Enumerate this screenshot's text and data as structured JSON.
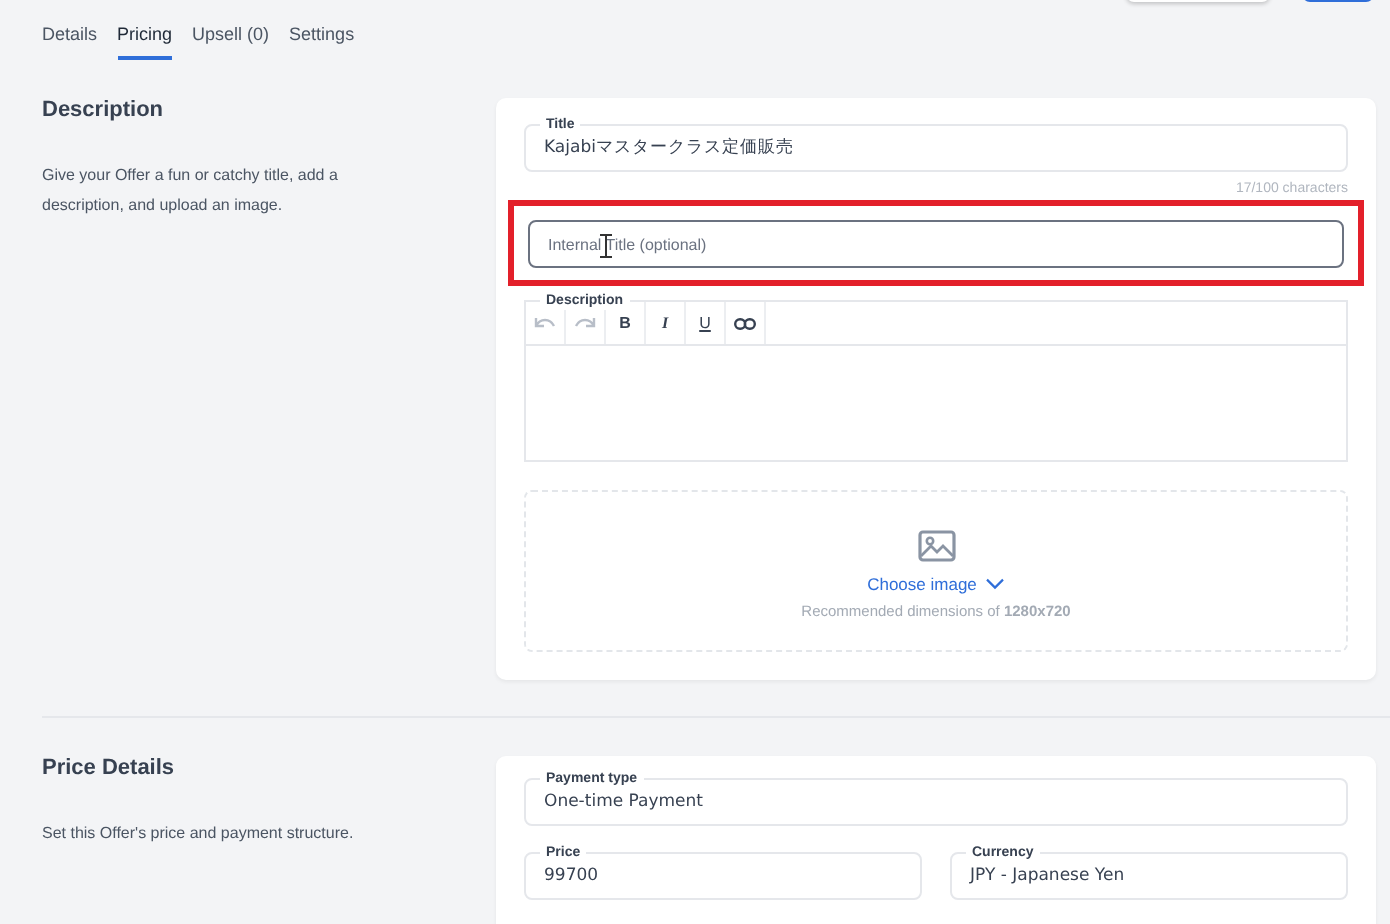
{
  "top_buttons": [
    {
      "kind": "secondary"
    },
    {
      "kind": "primary"
    }
  ],
  "tabs": [
    {
      "label": "Details",
      "selected": false
    },
    {
      "label": "Pricing",
      "selected": true
    },
    {
      "label": "Upsell (0)",
      "selected": false
    },
    {
      "label": "Settings",
      "selected": false
    }
  ],
  "description_section": {
    "heading": "Description",
    "text": "Give your Offer a fun or catchy title, add a description, and upload an image.",
    "title_field": {
      "label": "Title",
      "value": "Kajabiマスタークラス定価販売",
      "counter": "17/100 characters"
    },
    "internal_title_field": {
      "placeholder": "Internal Title (optional)",
      "highlighted": true
    },
    "description_editor": {
      "label": "Description",
      "toolbar": [
        {
          "kind": "undo",
          "disabled": true
        },
        {
          "kind": "redo",
          "disabled": true
        },
        {
          "kind": "bold",
          "label": "B",
          "disabled": false
        },
        {
          "kind": "italic",
          "label": "I",
          "disabled": false
        },
        {
          "kind": "underline",
          "label": "U",
          "disabled": false
        },
        {
          "kind": "link",
          "disabled": false
        }
      ]
    },
    "image_upload": {
      "action": "Choose image",
      "hint": "Recommended dimensions of **1280x720**"
    }
  },
  "price_section": {
    "heading": "Price Details",
    "text": "Set this Offer's price and payment structure.",
    "rows": [
      [
        {
          "label": "Payment type",
          "value": "One-time Payment"
        }
      ],
      [
        {
          "label": "Price",
          "value": "99700"
        },
        {
          "label": "Currency",
          "value": "JPY - Japanese Yen"
        }
      ]
    ]
  }
}
